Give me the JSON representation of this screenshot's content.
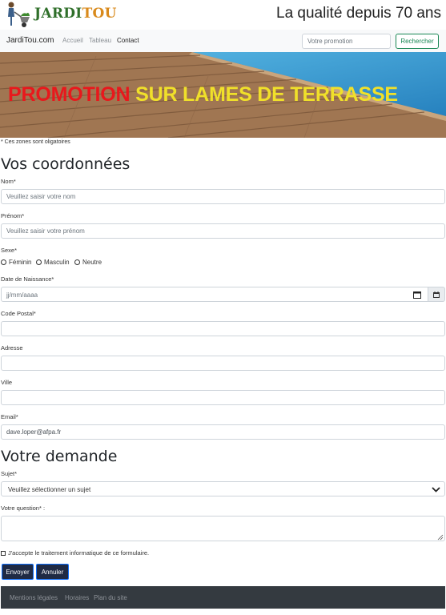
{
  "header": {
    "logo_part1": "JARDI",
    "logo_part2": "TOU",
    "tagline": "La qualité depuis 70 ans"
  },
  "nav": {
    "brand": "JardiTou.com",
    "links": [
      "Accueil",
      "Tableau",
      "Contact"
    ],
    "active_link": "Contact",
    "search_placeholder": "Votre promotion",
    "search_button": "Rechercher"
  },
  "banner": {
    "title_red": "PROMOTION",
    "title_yellow": "SUR LAMES DE TERRASSE"
  },
  "form": {
    "required_note": "* Ces zones sont oligatoires",
    "section_coordonnees": "Vos coordonnées",
    "nom_label": "Nom*",
    "nom_placeholder": "Veuillez saisir votre nom",
    "prenom_label": "Prénom*",
    "prenom_placeholder": "Veuillez saisir votre prénom",
    "sexe_label": "Sexe*",
    "sexe_options": [
      "Féminin",
      "Masculin",
      "Neutre"
    ],
    "date_label": "Date de Naissance*",
    "date_placeholder": "jj/mm/aaaa",
    "cp_label": "Code Postal*",
    "adresse_label": "Adresse",
    "ville_label": "Ville",
    "email_label": "Email*",
    "email_value": "dave.loper@afpa.fr",
    "section_demande": "Votre demande",
    "sujet_label": "Sujet*",
    "sujet_selected": "Veuillez sélectionner un sujet",
    "question_label": "Votre question* :",
    "accept_label": "J'accepte le traitement informatique de ce formulaire.",
    "submit_button": "Envoyer",
    "cancel_button": "Annuler"
  },
  "footer": {
    "links": [
      "Mentions légales",
      "Horaires",
      "Plan du site"
    ]
  },
  "colors": {
    "logo_green": "#2f6f2a",
    "logo_orange": "#d98a1c",
    "banner_red": "#e8181c",
    "banner_yellow": "#f0e02a",
    "search_green": "#198754",
    "button_dark": "#1f2a44",
    "footer_bg": "#343a40"
  },
  "icons": [
    "gardener-logo",
    "calendar-icon",
    "chevron-down-icon",
    "resize-grip-icon"
  ]
}
